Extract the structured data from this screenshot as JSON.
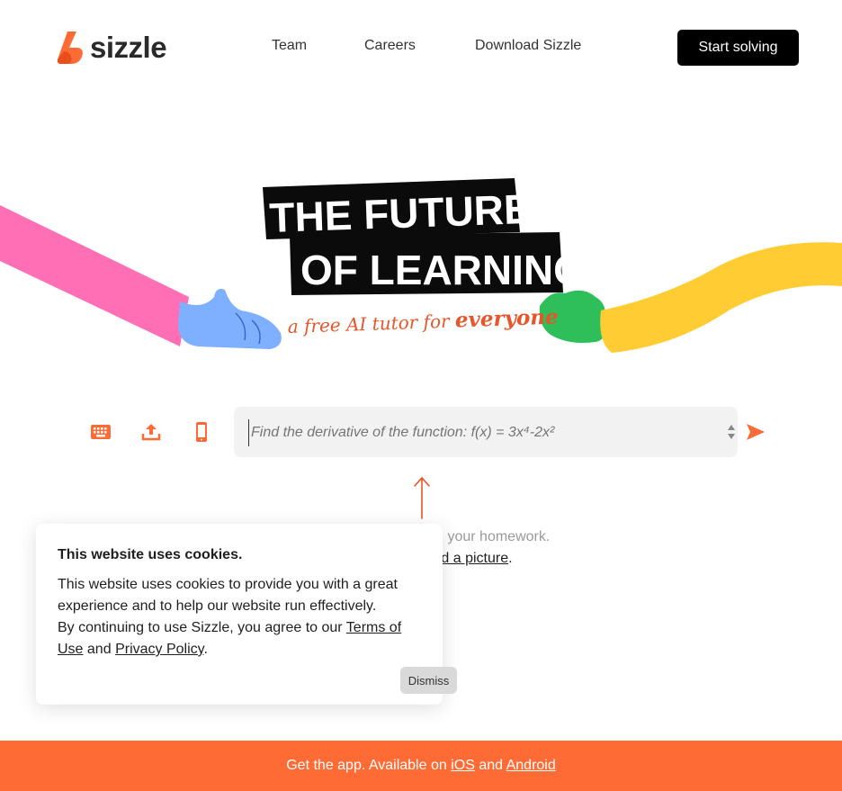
{
  "header": {
    "logo_text": "sizzle",
    "nav": [
      {
        "label": "Team"
      },
      {
        "label": "Careers"
      },
      {
        "label": "Download Sizzle"
      }
    ],
    "cta_label": "Start solving"
  },
  "hero": {
    "title_line1": "THE FUTURE",
    "title_line2": "OF LEARNING",
    "tagline_part1": "a free AI tutor for",
    "tagline_part2": "everyone"
  },
  "input": {
    "placeholder": "Find the derivative of the function: f(x) = 3x⁴-2x²",
    "tools": [
      "keyboard-icon",
      "upload-icon",
      "phone-icon"
    ]
  },
  "help": {
    "line1": "th your homework.",
    "line2_prefix": "r ",
    "line2_link": "upload a picture",
    "line2_suffix": "."
  },
  "cookie": {
    "title": "This website uses cookies.",
    "body1": "This website uses cookies to provide you with a great experience and to help our website run effectively.",
    "body2": "By continuing to use Sizzle, you agree to our",
    "terms_link": "Terms of Use",
    "and_text": "and",
    "privacy_link": "Privacy Policy",
    "period": ".",
    "dismiss_label": "Dismiss"
  },
  "banner": {
    "prefix": "Get the app. Available on",
    "ios": "iOS",
    "and": "and",
    "android": "Android"
  },
  "colors": {
    "brand": "#ff6b35",
    "cta_bg": "#000000",
    "banner_bg": "#ff6b35",
    "pink_arm": "#ff6fb5",
    "blue_hand": "#7fb0ff",
    "green_hand": "#2fbf5a",
    "yellow_arm": "#ffcc33"
  }
}
